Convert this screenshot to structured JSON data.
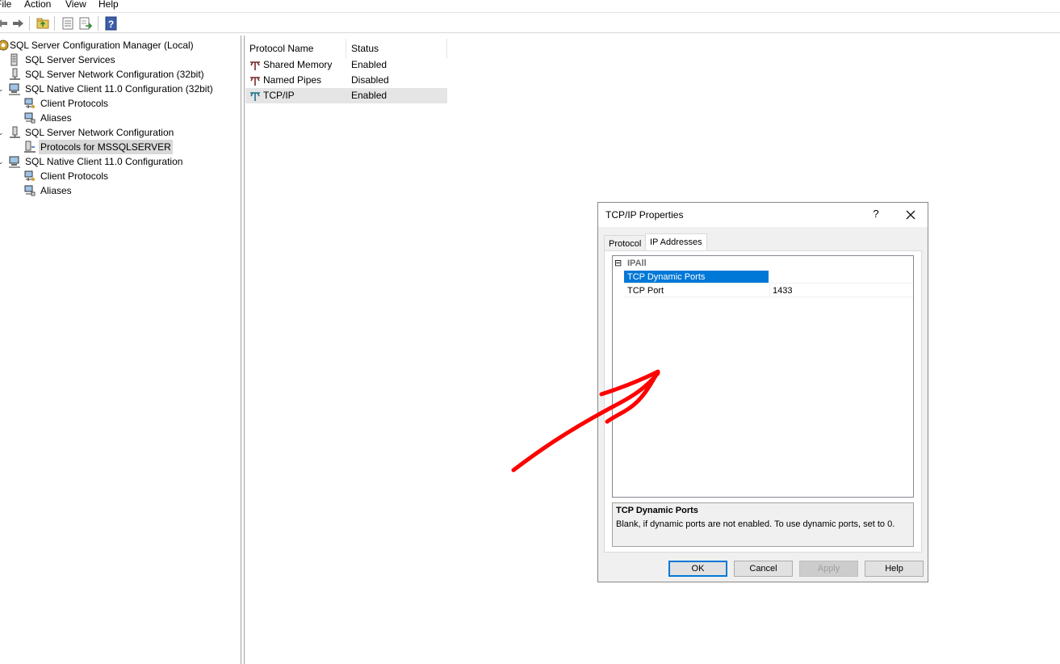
{
  "menu": [
    "File",
    "Action",
    "View",
    "Help"
  ],
  "toolbar": {
    "buttons": [
      "back-icon",
      "forward-icon",
      "up-folder-icon",
      "properties-icon",
      "export-list-icon",
      "help-icon"
    ]
  },
  "tree": {
    "root": "SQL Server Configuration Manager (Local)",
    "items": [
      {
        "label": "SQL Server Services"
      },
      {
        "label": "SQL Server Network Configuration (32bit)"
      },
      {
        "label": "SQL Native Client 11.0 Configuration (32bit)"
      },
      {
        "label": "Client Protocols"
      },
      {
        "label": "Aliases"
      },
      {
        "label": "SQL Server Network Configuration"
      },
      {
        "label": "Protocols for MSSQLSERVER"
      },
      {
        "label": "SQL Native Client 11.0 Configuration"
      },
      {
        "label": "Client Protocols"
      },
      {
        "label": "Aliases"
      }
    ]
  },
  "list": {
    "headers": [
      "Protocol Name",
      "Status"
    ],
    "rows": [
      {
        "name": "Shared Memory",
        "status": "Enabled"
      },
      {
        "name": "Named Pipes",
        "status": "Disabled"
      },
      {
        "name": "TCP/IP",
        "status": "Enabled"
      }
    ]
  },
  "dialog": {
    "title": "TCP/IP Properties",
    "help_glyph": "?",
    "tabs": [
      "Protocol",
      "IP Addresses"
    ],
    "grid": {
      "category": "IPAll",
      "collapse_glyph": "⊟",
      "properties": [
        {
          "name": "TCP Dynamic Ports",
          "value": ""
        },
        {
          "name": "TCP Port",
          "value": "1433"
        }
      ]
    },
    "help": {
      "title": "TCP Dynamic Ports",
      "description": "Blank, if dynamic ports are not enabled. To use dynamic ports, set to 0."
    },
    "buttons": {
      "ok": "OK",
      "cancel": "Cancel",
      "apply": "Apply",
      "help": "Help"
    }
  },
  "colors": {
    "selection": "#0078d7",
    "annotation": "#ff0000",
    "dialog_bg": "#f0f0f0"
  }
}
